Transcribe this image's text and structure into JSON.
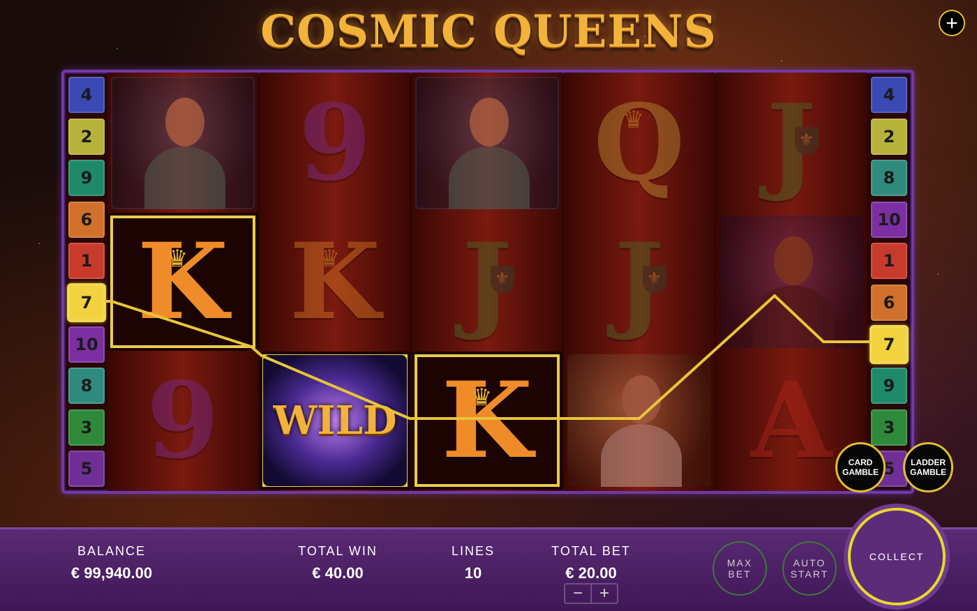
{
  "header": {
    "title": "COSMIC QUEENS",
    "plus_label": "+"
  },
  "paylines": {
    "left": [
      "4",
      "2",
      "9",
      "6",
      "1",
      "7",
      "10",
      "8",
      "3",
      "5"
    ],
    "right": [
      "4",
      "2",
      "8",
      "10",
      "1",
      "6",
      "7",
      "9",
      "3",
      "5"
    ],
    "colors": {
      "1": "#c83a2c",
      "2": "#b7b33a",
      "3": "#2e8a3a",
      "4": "#3a49b3",
      "5": "#6f2f97",
      "6": "#d0702a",
      "7": "#f2d23f",
      "8": "#2f8b7d",
      "9": "#1f8a6a",
      "10": "#7b2fa3"
    },
    "active_line": "7"
  },
  "reels": [
    [
      {
        "kind": "portrait",
        "symbol": "queen-blue",
        "dim": true
      },
      {
        "kind": "letter",
        "symbol": "K",
        "color": "#f08b2a",
        "crown": true,
        "dim": false,
        "highlight": true
      },
      {
        "kind": "letter",
        "symbol": "9",
        "color": "#7a2fa8",
        "dim": true
      }
    ],
    [
      {
        "kind": "letter",
        "symbol": "9",
        "color": "#7a2fa8",
        "dim": true
      },
      {
        "kind": "letter",
        "symbol": "K",
        "color": "#f08b2a",
        "crown": true,
        "dim": true
      },
      {
        "kind": "wild",
        "symbol": "WILD",
        "dim": false,
        "highlight": true
      }
    ],
    [
      {
        "kind": "portrait",
        "symbol": "queen-blue",
        "dim": true
      },
      {
        "kind": "letter",
        "symbol": "J",
        "color": "#3f7a2e",
        "fleur": true,
        "dim": true
      },
      {
        "kind": "letter",
        "symbol": "K",
        "color": "#f08b2a",
        "crown": true,
        "dim": false,
        "highlight": true
      }
    ],
    [
      {
        "kind": "letter",
        "symbol": "Q",
        "color": "#c9a53a",
        "crown": true,
        "dim": true
      },
      {
        "kind": "letter",
        "symbol": "J",
        "color": "#3f7a2e",
        "fleur": true,
        "dim": true
      },
      {
        "kind": "portrait",
        "symbol": "queen-gold",
        "dim": true
      }
    ],
    [
      {
        "kind": "letter",
        "symbol": "J",
        "color": "#3f7a2e",
        "fleur": true,
        "dim": true
      },
      {
        "kind": "portrait",
        "symbol": "queen-purple",
        "dim": true
      },
      {
        "kind": "letter",
        "symbol": "A",
        "color": "#b8261c",
        "dim": true
      }
    ]
  ],
  "gamble": {
    "card": "CARD GAMBLE",
    "ladder": "LADDER GAMBLE"
  },
  "stats": {
    "balance_label": "BALANCE",
    "balance_value": "€ 99,940.00",
    "win_label": "TOTAL WIN",
    "win_value": "€ 40.00",
    "lines_label": "LINES",
    "lines_value": "10",
    "bet_label": "TOTAL BET",
    "bet_value": "€ 20.00"
  },
  "controls": {
    "max_bet": "MAX BET",
    "auto_start": "AUTO START",
    "collect": "COLLECT",
    "minus": "−",
    "plus": "+"
  }
}
